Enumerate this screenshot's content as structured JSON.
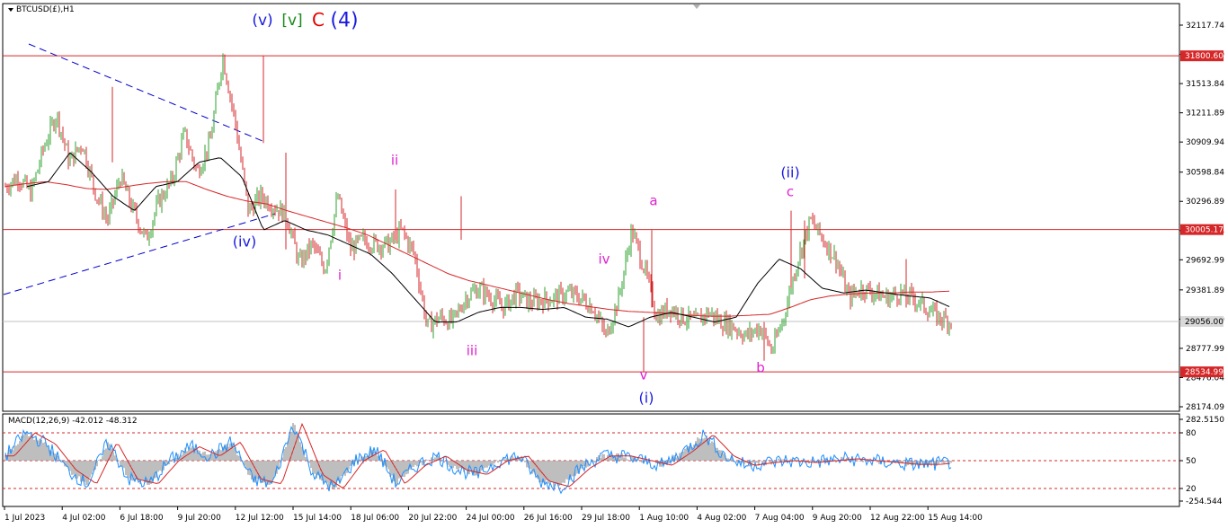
{
  "symbol_header": "BTCUSD(£),H1",
  "indicator_header": "MACD(12,26,9) -42.012 -48.312",
  "colors": {
    "bull": "#2ca02c",
    "bear": "#d62728",
    "hline": "#d62728",
    "ma_red": "#d62728",
    "ma_black": "#000000",
    "trend": "#0000cc",
    "wave_blue": "#1a1adf",
    "wave_magenta": "#e020d0",
    "wave_green": "#1a8a1a",
    "wave_red": "#e00000",
    "macd_line": "#1e90ff",
    "macd_hist": "#a9a9a9",
    "signal_line": "#d62728"
  },
  "price_axis": {
    "ticks": [
      "32117.74",
      "31815.79",
      "31513.84",
      "31211.89",
      "30909.94",
      "30598.84",
      "30296.89",
      "29994.94",
      "29692.99",
      "29381.89",
      "29080.00",
      "28777.99",
      "28476.04",
      "28174.09"
    ],
    "tick_values": [
      32117.74,
      31815.79,
      31513.84,
      31211.89,
      30909.94,
      30598.84,
      30296.89,
      29994.94,
      29692.99,
      29381.89,
      29080.0,
      28777.99,
      28476.04,
      28174.09
    ],
    "range": [
      28174.09,
      32300
    ]
  },
  "levels": [
    {
      "label": "31800.60",
      "value": 31800.6,
      "kind": "red"
    },
    {
      "label": "30005.17",
      "value": 30005.17,
      "kind": "red"
    },
    {
      "label": "29056.00",
      "value": 29056.0,
      "kind": "current"
    },
    {
      "label": "28534.99",
      "value": 28534.99,
      "kind": "red"
    }
  ],
  "macd_axis": {
    "ticks": [
      "282.5150",
      "80",
      "50",
      "20",
      "-254.544"
    ],
    "levels": [
      "80",
      "50",
      "20"
    ]
  },
  "time_axis": [
    "1 Jul 2023",
    "4 Jul 02:00",
    "6 Jul 18:00",
    "9 Jul 20:00",
    "12 Jul 12:00",
    "15 Jul 14:00",
    "18 Jul 06:00",
    "20 Jul 22:00",
    "24 Jul 00:00",
    "26 Jul 16:00",
    "29 Jul 18:00",
    "1 Aug 10:00",
    "4 Aug 02:00",
    "7 Aug 04:00",
    "9 Aug 20:00",
    "12 Aug 22:00",
    "15 Aug 14:00"
  ],
  "wave_labels": [
    {
      "text": "(v)",
      "color": "wave_blue",
      "price": 32045
    },
    {
      "text": "[v]",
      "color": "wave_green",
      "price": 32045
    },
    {
      "text": "C",
      "color": "wave_red",
      "price": 32045
    },
    {
      "text": "(4)",
      "color": "wave_blue",
      "price": 32045
    },
    {
      "text": "(iv)",
      "color": "wave_blue",
      "price": 29830
    },
    {
      "text": "ii",
      "color": "wave_magenta",
      "price": 30670
    },
    {
      "text": "i",
      "color": "wave_magenta",
      "price": 29480
    },
    {
      "text": "iii",
      "color": "wave_magenta",
      "price": 28660
    },
    {
      "text": "iv",
      "color": "wave_magenta",
      "price": 29590
    },
    {
      "text": "a",
      "color": "wave_magenta",
      "price": 30245
    },
    {
      "text": "v",
      "color": "wave_magenta",
      "price": 28455
    },
    {
      "text": "(i)",
      "color": "wave_blue",
      "price": 28200
    },
    {
      "text": "b",
      "color": "wave_magenta",
      "price": 28385
    },
    {
      "text": "(ii)",
      "color": "wave_blue",
      "price": 30555
    },
    {
      "text": "c",
      "color": "wave_magenta",
      "price": 30330
    }
  ],
  "chart_data": {
    "type": "candlestick",
    "x": [
      "1 Jul 2023",
      "4 Jul 02:00",
      "6 Jul 18:00",
      "9 Jul 20:00",
      "12 Jul 12:00",
      "15 Jul 14:00",
      "18 Jul 06:00",
      "20 Jul 22:00",
      "24 Jul 00:00",
      "26 Jul 16:00",
      "29 Jul 18:00",
      "1 Aug 10:00",
      "4 Aug 02:00",
      "7 Aug 04:00",
      "9 Aug 20:00",
      "12 Aug 22:00",
      "15 Aug 14:00"
    ],
    "close_path": [
      30450,
      30550,
      30380,
      30850,
      31200,
      30700,
      30900,
      30400,
      30100,
      30550,
      30200,
      29900,
      30300,
      30500,
      31000,
      30600,
      30900,
      31800,
      31100,
      30200,
      30350,
      30250,
      30150,
      29650,
      29850,
      29600,
      30350,
      29800,
      29900,
      29850,
      29850,
      30000,
      29750,
      29000,
      29100,
      29050,
      29300,
      29400,
      29300,
      29200,
      29350,
      29250,
      29280,
      29300,
      29350,
      29300,
      29200,
      28900,
      29300,
      30000,
      29600,
      29100,
      29200,
      29100,
      29050,
      29150,
      29050,
      29000,
      28900,
      29000,
      28750,
      29150,
      29700,
      30100,
      29900,
      29700,
      29300,
      29400,
      29350,
      29300,
      29350,
      29300,
      29200,
      29100,
      29050
    ],
    "ma_long_path": [
      30450,
      30480,
      30500,
      30470,
      30430,
      30420,
      30450,
      30480,
      30500,
      30500,
      30420,
      30350,
      30300,
      30270,
      30200,
      30140,
      30080,
      30020,
      29950,
      29850,
      29750,
      29650,
      29550,
      29480,
      29430,
      29380,
      29330,
      29280,
      29240,
      29210,
      29180,
      29160,
      29150,
      29140,
      29120,
      29110,
      29110,
      29120,
      29130,
      29200,
      29280,
      29320,
      29340,
      29350,
      29350,
      29360,
      29360,
      29370
    ],
    "ma_short_path": [
      30450,
      30500,
      30800,
      30600,
      30350,
      30200,
      30450,
      30500,
      30700,
      30750,
      30550,
      30000,
      30100,
      30000,
      29950,
      29850,
      29750,
      29550,
      29300,
      29050,
      29050,
      29150,
      29200,
      29200,
      29180,
      29200,
      29100,
      29080,
      29000,
      29100,
      29150,
      29100,
      29050,
      29100,
      29450,
      29700,
      29600,
      29400,
      29350,
      29380,
      29350,
      29320,
      29300,
      29200
    ],
    "macd_path": [
      55,
      80,
      68,
      40,
      25,
      70,
      30,
      25,
      50,
      65,
      55,
      70,
      30,
      25,
      90,
      35,
      20,
      50,
      62,
      25,
      45,
      55,
      40,
      35,
      50,
      55,
      28,
      22,
      42,
      55,
      55,
      50,
      45,
      60,
      78,
      55,
      45,
      48,
      50,
      48,
      50,
      52,
      50,
      48,
      46,
      46,
      48
    ]
  }
}
